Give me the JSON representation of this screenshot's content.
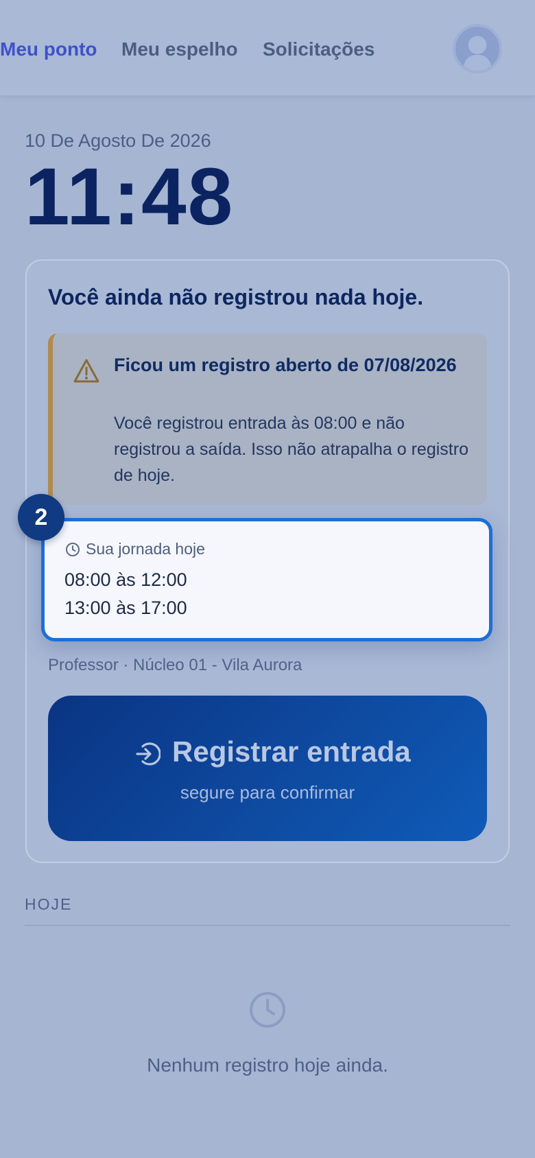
{
  "nav": {
    "items": [
      {
        "label": "Meu ponto",
        "active": true
      },
      {
        "label": "Meu espelho",
        "active": false
      },
      {
        "label": "Solicitações",
        "active": false
      }
    ]
  },
  "date": "10 De Agosto De 2026",
  "time": "11:48",
  "card": {
    "title": "Você ainda não registrou nada hoje.",
    "warning": {
      "title": "Ficou um registro aberto de 07/08/2026",
      "text": "Você registrou entrada às 08:00 e não registrou a saída. Isso não atrapalha o registro de hoje.",
      "icon": "warning-triangle-icon"
    },
    "journey": {
      "step": "2",
      "label": "Sua jornada hoje",
      "periods": [
        "08:00 às 12:00",
        "13:00 às 17:00"
      ]
    },
    "location": "Professor · Núcleo 01 - Vila Aurora",
    "register_button": {
      "label": "Registrar entrada",
      "sublabel": "segure para confirmar",
      "icon": "login-arrow-icon"
    }
  },
  "today": {
    "heading": "HOJE",
    "empty_text": "Nenhum registro hoje ainda."
  },
  "colors": {
    "overlay_bg": "#a6b5d2",
    "active_nav": "#3e52c9",
    "clock": "#0b2461",
    "highlight_border": "#1d6fd6",
    "button_start": "#0a3483",
    "button_end": "#0f5bb8",
    "warning_accent": "#b08b4f"
  }
}
